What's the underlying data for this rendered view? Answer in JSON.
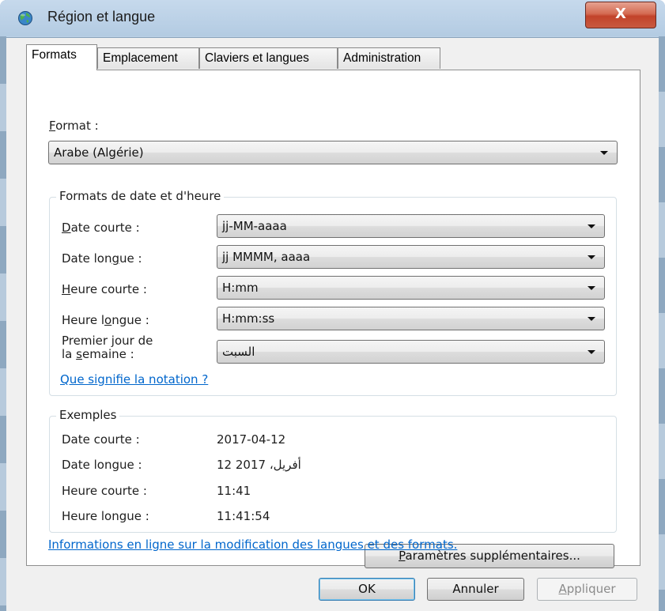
{
  "window": {
    "title": "Région et langue",
    "close_glyph": "X"
  },
  "tabs": [
    {
      "label": "Formats",
      "active": true
    },
    {
      "label": "Emplacement",
      "active": false
    },
    {
      "label": "Claviers et langues",
      "active": false
    },
    {
      "label": "Administration",
      "active": false
    }
  ],
  "format": {
    "label_accel": "F",
    "label_rest": "ormat :",
    "value": "Arabe (Algérie)"
  },
  "date_time_formats": {
    "group_title": "Formats de date et d'heure",
    "short_date": {
      "label_accel": "D",
      "label_rest": "ate courte :",
      "value": "jj-MM-aaaa"
    },
    "long_date": {
      "label_pre": "Date lon",
      "label_accel": "g",
      "label_rest": "ue :",
      "value": "jj MMMM, aaaa"
    },
    "short_time": {
      "label_accel": "H",
      "label_rest": "eure courte :",
      "value": "H:mm"
    },
    "long_time": {
      "label_pre": "Heure l",
      "label_accel": "o",
      "label_rest": "ngue :",
      "value": "H:mm:ss"
    },
    "first_day": {
      "label_line1": "Premier jour de",
      "label_pre": "la ",
      "label_accel": "s",
      "label_rest": "emaine :",
      "value": "السبت"
    },
    "notation_link": "Que signifie la notation ?"
  },
  "examples": {
    "group_title": "Exemples",
    "rows": [
      {
        "label": "Date courte :",
        "value": "2017-04-12"
      },
      {
        "label": "Date longue :",
        "value": "12 أفريل، 2017"
      },
      {
        "label": "Heure courte :",
        "value": "11:41"
      },
      {
        "label": "Heure longue :",
        "value": "11:41:54"
      }
    ]
  },
  "additional_settings": {
    "accel": "P",
    "rest": "aramètres supplémentaires..."
  },
  "online_info_link": "Informations en ligne sur la modification des langues et des formats.",
  "footer": {
    "ok": "OK",
    "cancel": "Annuler",
    "apply_accel": "A",
    "apply_rest": "ppliquer"
  },
  "icons": [
    "globe-icon",
    "close-icon",
    "chevron-down-icon"
  ],
  "colors": {
    "link": "#0066cc",
    "close_button": "#c8452c",
    "frame": "#b3cbe2"
  }
}
